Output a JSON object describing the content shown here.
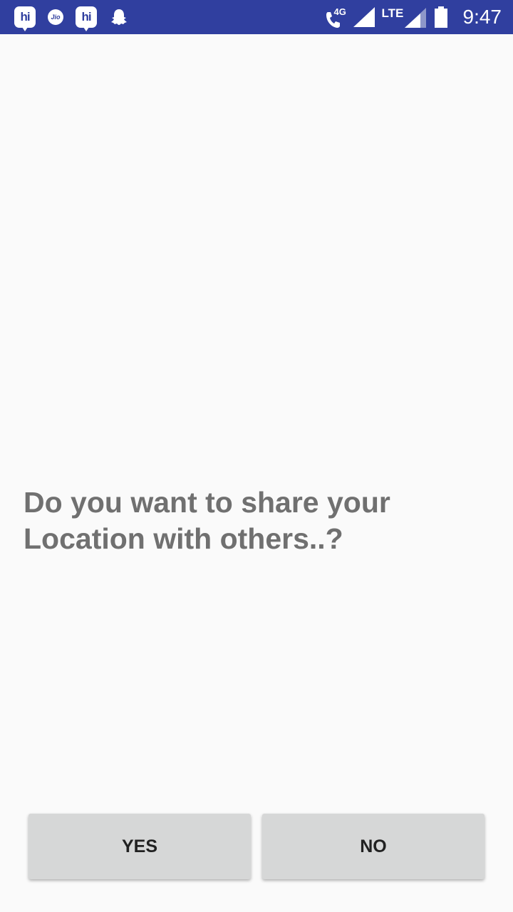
{
  "status_bar": {
    "time": "9:47",
    "network_type": "LTE",
    "call_tag": "4G",
    "app_icons": [
      {
        "name": "hike-icon",
        "label": "hi"
      },
      {
        "name": "jio-icon",
        "label": "Jio"
      },
      {
        "name": "hike-icon-2",
        "label": "hi"
      },
      {
        "name": "snapchat-ghost-icon",
        "label": ""
      }
    ],
    "color": "#303f9f"
  },
  "prompt": {
    "question": "Do you want to share your Location with others..?"
  },
  "actions": {
    "yes_label": "YES",
    "no_label": "NO"
  },
  "colors": {
    "background": "#fafafa",
    "question_text": "#707070",
    "button_bg": "#d6d7d7",
    "button_text": "#212121"
  }
}
